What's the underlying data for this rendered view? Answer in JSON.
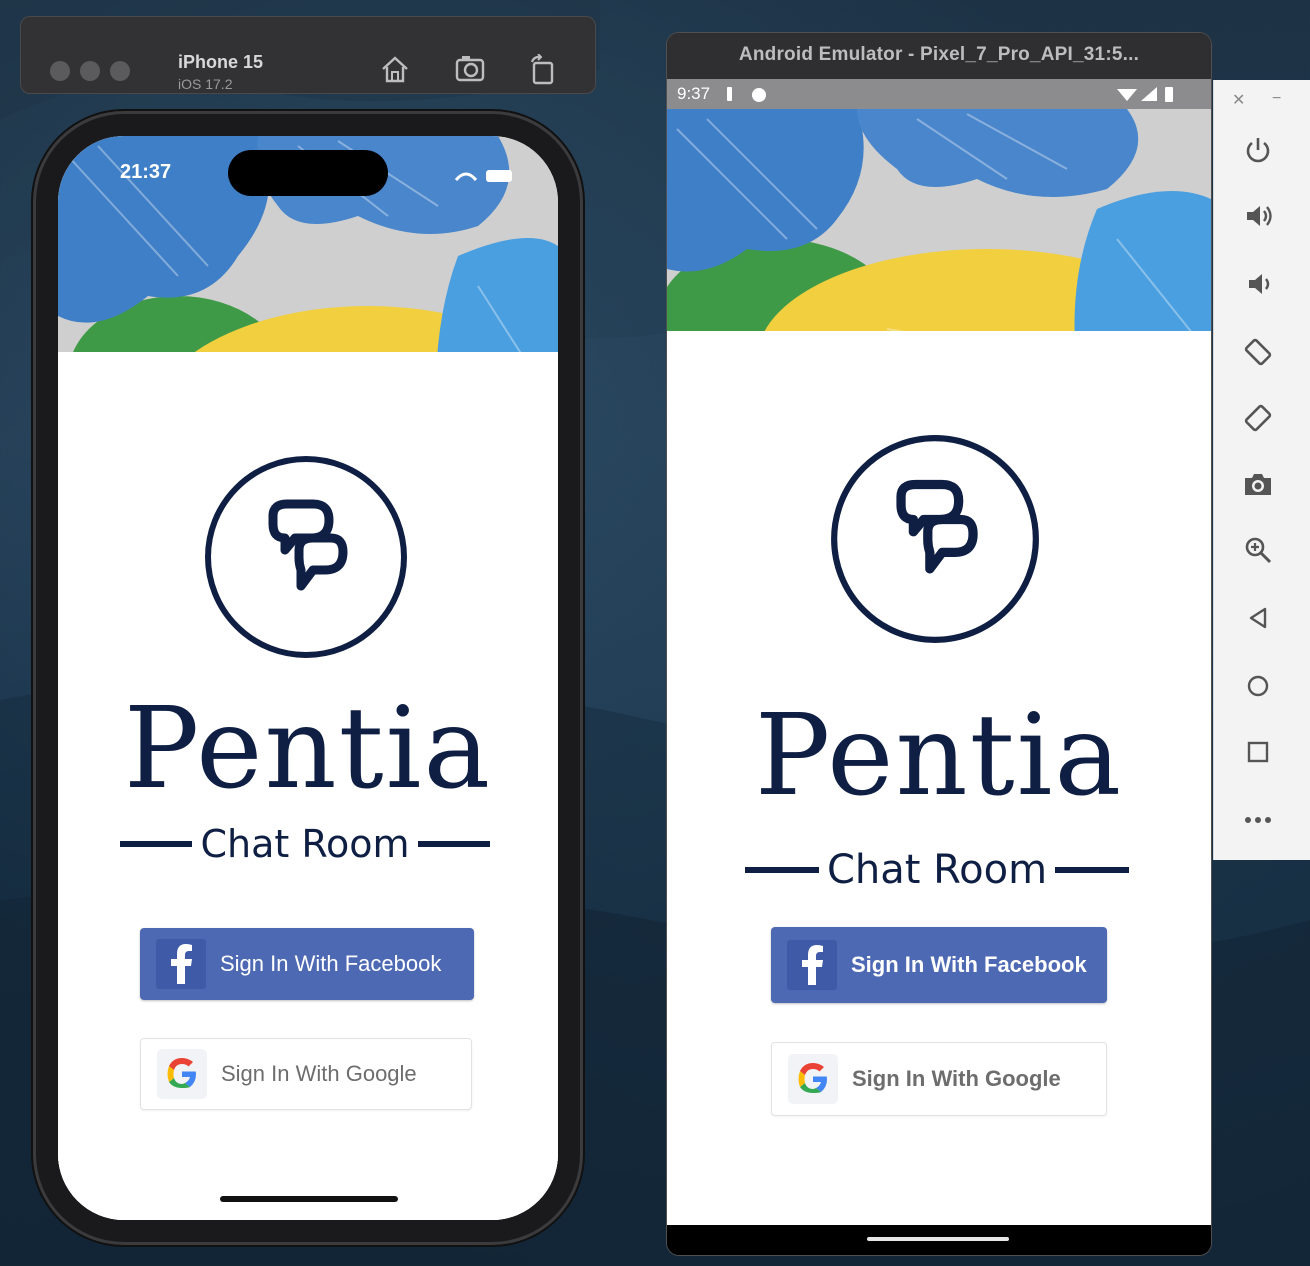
{
  "ios_simulator": {
    "device_name": "iPhone 15",
    "os_version": "iOS 17.2",
    "toolbar_icons": [
      "home-icon",
      "screenshot-icon",
      "rotate-icon"
    ],
    "status_time": "21:37"
  },
  "android_emulator": {
    "window_title": "Android Emulator - Pixel_7_Pro_API_31:5...",
    "status_time": "9:37",
    "side_controls": [
      "close-icon",
      "minimize-icon",
      "power-icon",
      "volume-up-icon",
      "volume-down-icon",
      "rotate-left-icon",
      "rotate-right-icon",
      "camera-icon",
      "zoom-icon",
      "back-icon",
      "home-icon",
      "overview-icon",
      "more-icon"
    ]
  },
  "app": {
    "brand_name": "Pentia",
    "subtitle": "Chat Room",
    "facebook_button": "Sign In With Facebook",
    "google_button": "Sign In With Google",
    "colors": {
      "brand_navy": "#0f1f44",
      "facebook_blue": "#4e69b3",
      "card_white": "#ffffff"
    }
  }
}
